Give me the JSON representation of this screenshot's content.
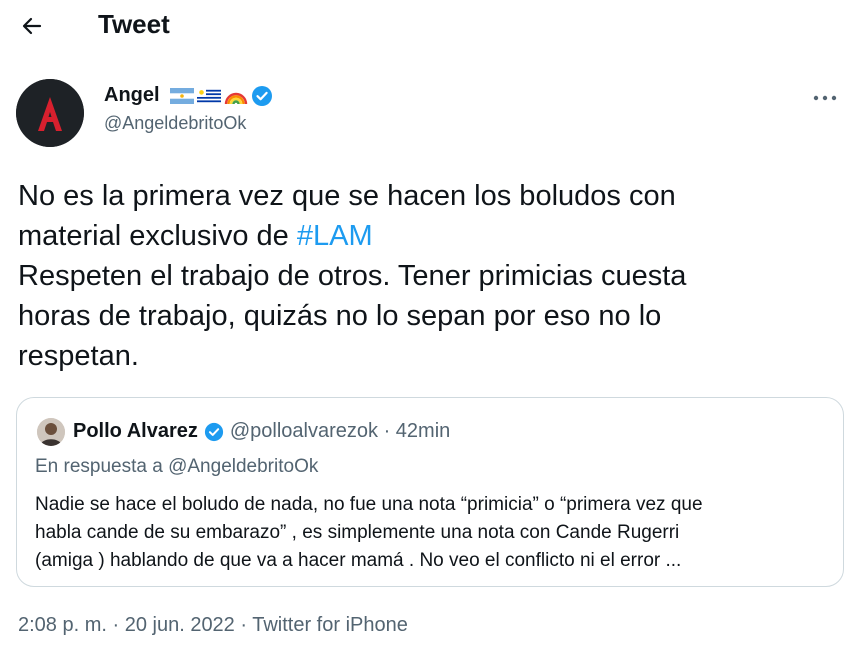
{
  "header": {
    "title": "Tweet",
    "back_icon": "arrow-left-icon"
  },
  "author": {
    "avatar_letter": "A",
    "name": "Angel",
    "emojis": [
      "argentina-flag-icon",
      "uruguay-flag-icon",
      "rainbow-icon"
    ],
    "verified_icon": "verified-badge-icon",
    "handle": "@AngeldebritoOk"
  },
  "more_icon": "more-dots-icon",
  "tweet": {
    "line1": "No es la primera vez que se hacen los boludos con",
    "line2_prefix": "material exclusivo de ",
    "hashtag": "#LAM",
    "line3": "Respeten el trabajo de otros. Tener primicias cuesta",
    "line4": "horas de trabajo, quizás no lo sepan por eso no lo",
    "line5": "respetan."
  },
  "quote": {
    "name": "Pollo Alvarez",
    "handle_time": "@polloalvarezok · 42min",
    "reply_prefix": "En respuesta a ",
    "reply_to": "@AngeldebritoOk",
    "body_line1": "Nadie se hace el boludo de nada, no fue una nota “primicia” o “primera vez que",
    "body_line2": "habla cande de su embarazo” , es simplemente una nota con Cande Rugerri",
    "body_line3": "(amiga ) hablando de que va a hacer mamá . No veo el conflicto ni el error ..."
  },
  "meta": {
    "datetime": "2:08 p. m. · 20 jun. 2022 · ",
    "source": "Twitter for iPhone"
  },
  "colors": {
    "accent": "#1d9bf0",
    "secondary_text": "#536471",
    "border": "#cfd9de"
  }
}
